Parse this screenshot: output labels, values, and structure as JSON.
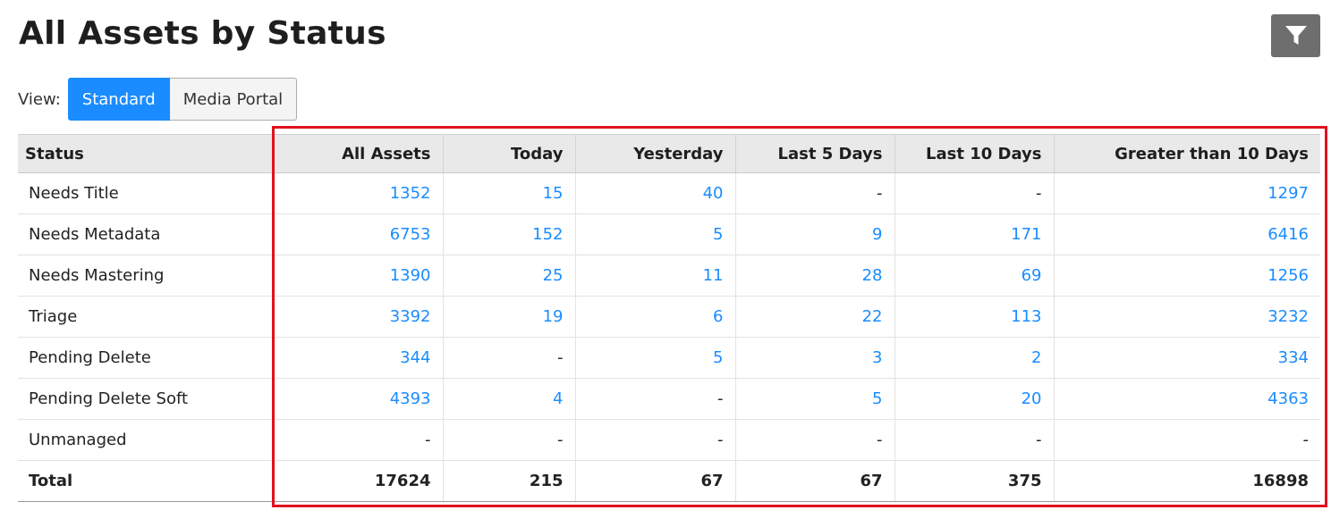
{
  "page": {
    "title": "All Assets by Status"
  },
  "filter_button": {
    "icon": "funnel-icon"
  },
  "view": {
    "label": "View:",
    "options": [
      {
        "label": "Standard",
        "active": true
      },
      {
        "label": "Media Portal",
        "active": false
      }
    ]
  },
  "table": {
    "columns": [
      "Status",
      "All Assets",
      "Today",
      "Yesterday",
      "Last 5 Days",
      "Last 10 Days",
      "Greater than 10 Days"
    ],
    "rows": [
      {
        "status": "Needs Title",
        "values": [
          "1352",
          "15",
          "40",
          "-",
          "-",
          "1297"
        ]
      },
      {
        "status": "Needs Metadata",
        "values": [
          "6753",
          "152",
          "5",
          "9",
          "171",
          "6416"
        ]
      },
      {
        "status": "Needs Mastering",
        "values": [
          "1390",
          "25",
          "11",
          "28",
          "69",
          "1256"
        ]
      },
      {
        "status": "Triage",
        "values": [
          "3392",
          "19",
          "6",
          "22",
          "113",
          "3232"
        ]
      },
      {
        "status": "Pending Delete",
        "values": [
          "344",
          "-",
          "5",
          "3",
          "2",
          "334"
        ]
      },
      {
        "status": "Pending Delete Soft",
        "values": [
          "4393",
          "4",
          "-",
          "5",
          "20",
          "4363"
        ]
      },
      {
        "status": "Unmanaged",
        "values": [
          "-",
          "-",
          "-",
          "-",
          "-",
          "-"
        ]
      }
    ],
    "total": {
      "status": "Total",
      "values": [
        "17624",
        "215",
        "67",
        "67",
        "375",
        "16898"
      ]
    }
  },
  "colors": {
    "link": "#1a8cff",
    "highlight": "#e0121f",
    "filter_bg": "#6e6e6e"
  }
}
